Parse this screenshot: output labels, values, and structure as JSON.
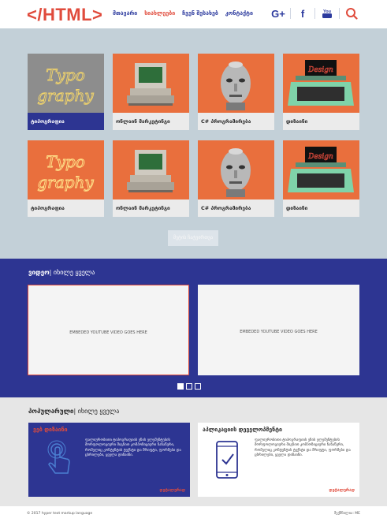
{
  "header": {
    "logo": "</HTML>",
    "nav": [
      "მთავარი",
      "სიახლეები",
      "ჩვენ შესახებ",
      "კონტაქტი"
    ],
    "active_nav": 1,
    "social": {
      "google_plus": "G+",
      "facebook": "f",
      "youtube": "You"
    }
  },
  "blog": {
    "cards": [
      {
        "label": "ტიპოგრაფია",
        "img": "typo-neon",
        "selected": true
      },
      {
        "label": "ონლაინ მარკეტინგი",
        "img": "computer"
      },
      {
        "label": "C# პროგრამირება",
        "img": "robot"
      },
      {
        "label": "დიზაინი",
        "img": "typewriter"
      },
      {
        "label": "ტიპოგრაფია",
        "img": "typo-neon"
      },
      {
        "label": "ონლაინ მარკეტინგი",
        "img": "computer"
      },
      {
        "label": "C# პროგრამირება",
        "img": "robot"
      },
      {
        "label": "დიზაინი",
        "img": "typewriter"
      }
    ],
    "more_button": "მეტის ჩატვირთვა"
  },
  "videos": {
    "title": "ვიდეო",
    "see_all": "| იხილე ყველა",
    "items": [
      "EMBEDED YOUTUBE VIDEO GOES HERE",
      "EMBEDED YOUTUBE VIDEO GOES HERE"
    ],
    "pager_active": 0,
    "pager_count": 3
  },
  "popular": {
    "title": "პოპულარული",
    "see_all": "| იხილე ყველა",
    "cards": [
      {
        "title": "ვებ დიზაინი",
        "text": "ფალიურობითი ტიპოგრაფიის ენის ელემენტების მორფოლოგიური შიგნით კომპოზიციური ჩანაწერი, რომელიც კონტენტის ტექსტი და შრიფტი, ფორმები და ცხრილები, ყველა დიზაინი.",
        "more": "დეტალურად",
        "icon": "touch-gesture-icon"
      },
      {
        "title": "აპლიკაციის დეველოპმენტი",
        "text": "ფალიურობითი ტიპოგრაფიის ენის ელემენტების მორფოლოგიური შიგნით კომპოზიციური ჩანაწერი, რომელიც კონტენტის ტექსტი და შრიფტი, ფორმები და ცხრილები, ყველა დიზაინი.",
        "more": "დეტალურად",
        "icon": "mobile-check-icon"
      }
    ]
  },
  "footer": {
    "copyright": "© 2017 hyper text markup language",
    "credit": "შექმნილია: ME"
  },
  "colors": {
    "accent": "#e04b3c",
    "brand": "#2d3592",
    "panel": "#c3d0d8"
  }
}
